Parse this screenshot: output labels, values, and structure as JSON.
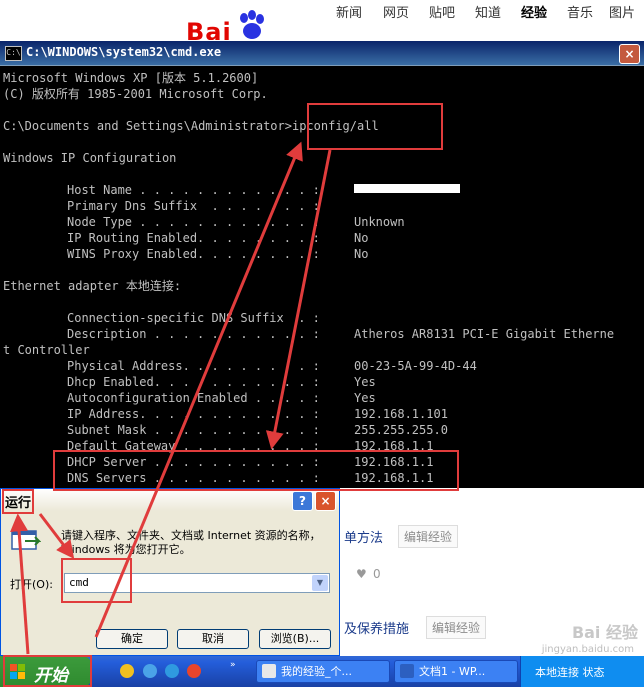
{
  "baidu": {
    "logo_text": "Bai",
    "logo_suffix": "经验",
    "nav": [
      "新闻",
      "网页",
      "贴吧",
      "知道",
      "经验",
      "音乐",
      "图片"
    ],
    "active_nav": "经验"
  },
  "cmd": {
    "title": "C:\\WINDOWS\\system32\\cmd.exe",
    "icon": "C:\\",
    "close": "×",
    "lines": {
      "l1": "Microsoft Windows XP [版本 5.1.2600]",
      "l2": "(C) 版权所有 1985-2001 Microsoft Corp.",
      "prompt": "C:\\Documents and Settings\\Administrator>ipconfig/all",
      "winip": "Windows IP Configuration",
      "eth": "Ethernet adapter 本地连接:",
      "wrap": "t Controller"
    },
    "global": [
      {
        "label": "Host Name . . . . . . . . . . . . :",
        "value": ""
      },
      {
        "label": "Primary Dns Suffix  . . . . . . . :",
        "value": ""
      },
      {
        "label": "Node Type . . . . . . . . . . . . :",
        "value": "Unknown"
      },
      {
        "label": "IP Routing Enabled. . . . . . . . :",
        "value": "No"
      },
      {
        "label": "WINS Proxy Enabled. . . . . . . . :",
        "value": "No"
      }
    ],
    "adapter": [
      {
        "label": "Connection-specific DNS Suffix  . :",
        "value": ""
      },
      {
        "label": "Description . . . . . . . . . . . :",
        "value": "Atheros AR8131 PCI-E Gigabit Etherne"
      },
      {
        "label": "Physical Address. . . . . . . . . :",
        "value": "00-23-5A-99-4D-44"
      },
      {
        "label": "Dhcp Enabled. . . . . . . . . . . :",
        "value": "Yes"
      },
      {
        "label": "Autoconfiguration Enabled . . . . :",
        "value": "Yes"
      },
      {
        "label": "IP Address. . . . . . . . . . . . :",
        "value": "192.168.1.101"
      },
      {
        "label": "Subnet Mask . . . . . . . . . . . :",
        "value": "255.255.255.0"
      },
      {
        "label": "Default Gateway . . . . . . . . . :",
        "value": "192.168.1.1"
      },
      {
        "label": "DHCP Server . . . . . . . . . . . :",
        "value": "192.168.1.1"
      },
      {
        "label": "DNS Servers . . . . . . . . . . . :",
        "value": "192.168.1.1"
      }
    ]
  },
  "page": {
    "method": "单方法",
    "edit1": "编辑经验",
    "likes": "0",
    "protect": "及保养措施",
    "edit2": "编辑经验",
    "watermark": "Bai 经验",
    "watermark_url": "jingyan.baidu.com"
  },
  "run": {
    "title": "运行",
    "help": "?",
    "close": "×",
    "description": "请键入程序、文件夹、文档或 Internet 资源的名称，Windows 将为您打开它。",
    "open_label": "打开(O):",
    "input_value": "cmd",
    "ok": "确定",
    "cancel": "取消",
    "browse": "浏览(B)..."
  },
  "taskbar": {
    "start": "开始",
    "tasks": [
      "我的经验_个...",
      "文档1 - WP..."
    ],
    "tray": "本地连接  状态"
  },
  "colors": {
    "annotation": "#e03c3c",
    "cmd_bg": "#000000",
    "cmd_fg": "#c0c0c0",
    "taskbar": "#245edb",
    "start": "#3c9b3c"
  }
}
